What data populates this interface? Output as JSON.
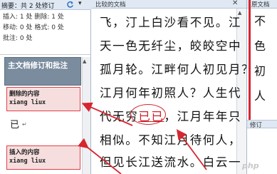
{
  "revision_pane": {
    "summary": "摘要：共 2 处修订",
    "stats": {
      "line1": "插入: 1 处  删除: 1 处",
      "line2": "移动: 0 处  格式: 0 处",
      "line3": "批注: 0 处"
    },
    "main_header": "主文档修订和批注",
    "deletion": {
      "title": "删除的内容",
      "author": "xiang liux",
      "content": "已"
    },
    "insertion": {
      "title": "插入的内容",
      "author": "xiang liux"
    }
  },
  "document": {
    "title": "比较的文档",
    "lines": {
      "l1": "飞，汀上白沙看不见。江",
      "l2": "天一色无纤尘，皎皎空中",
      "l3": "孤月轮。江畔何人初见月？",
      "l4": "江月何年初照人？人生代",
      "l5_before": "代无穷",
      "l5_inserted": "已已",
      "l5_after": "，江月年年只",
      "l6": "相似。不知江月待何人，",
      "l7": "但见长江送流水。白云一"
    }
  },
  "right_pane": {
    "title": "原文档",
    "bottom_title": "修订",
    "lines": [
      "不",
      "色",
      "初",
      "人"
    ]
  },
  "watermark": "php",
  "colors": {
    "revision_red": "#d62630",
    "header_bg": "#7a8c9e",
    "annotation_bg": "#f6dede"
  },
  "icons": [
    "refresh-icon",
    "chevron-down-icon",
    "close-icon",
    "scroll-up-icon",
    "pilcrow-icon"
  ]
}
